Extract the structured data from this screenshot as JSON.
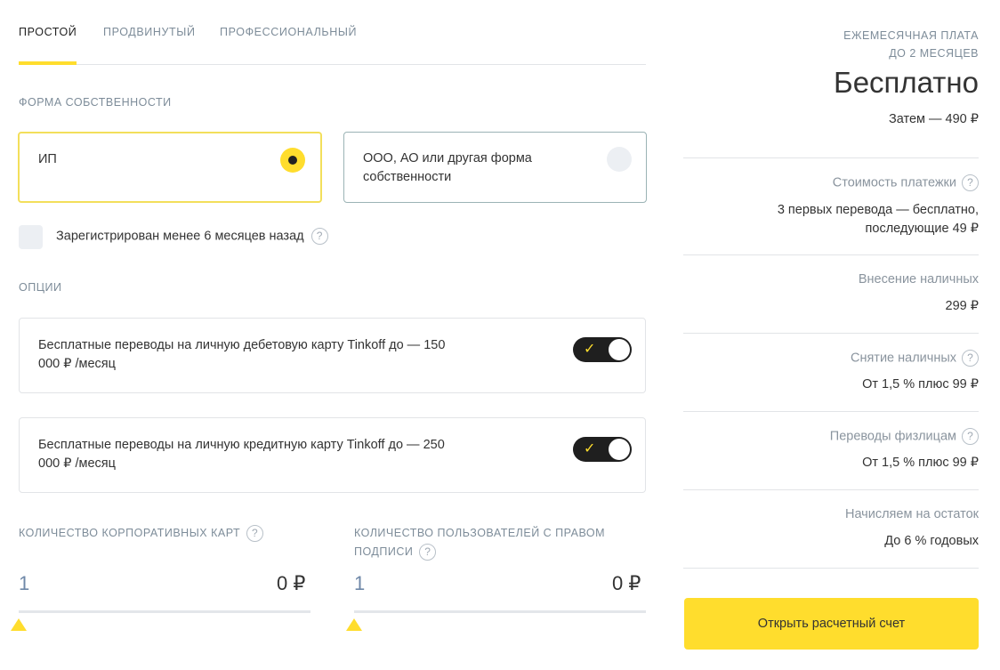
{
  "tabs": [
    {
      "label": "ПРОСТОЙ",
      "active": true
    },
    {
      "label": "ПРОДВИНУТЫЙ",
      "active": false
    },
    {
      "label": "ПРОФЕССИОНАЛЬНЫЙ",
      "active": false
    }
  ],
  "ownership": {
    "label": "ФОРМА СОБСТВЕННОСТИ",
    "options": [
      {
        "label": "ИП",
        "selected": true
      },
      {
        "label": "ООО, АО или другая форма собственности",
        "selected": false
      }
    ]
  },
  "registered": {
    "label": "Зарегистрирован менее 6 месяцев назад",
    "checked": false,
    "help": "?"
  },
  "options": {
    "label": "ОПЦИИ",
    "items": [
      {
        "text": "Бесплатные переводы на личную дебетовую карту Tinkoff до — 150 000 ₽ /месяц",
        "enabled": true
      },
      {
        "text": "Бесплатные переводы на личную кредитную карту Tinkoff до — 250 000 ₽ /месяц",
        "enabled": true
      }
    ]
  },
  "sliders": [
    {
      "label": "КОЛИЧЕСТВО КОРПОРАТИВНЫХ КАРТ",
      "value": "1",
      "price": "0 ₽",
      "help": "?"
    },
    {
      "label": "КОЛИЧЕСТВО ПОЛЬЗОВАТЕЛЕЙ С ПРАВОМ ПОДПИСИ",
      "value": "1",
      "price": "0 ₽",
      "help": "?"
    }
  ],
  "summary": {
    "fee_caption_line1": "ЕЖЕМЕСЯЧНАЯ ПЛАТА",
    "fee_caption_line2": "ДО 2 МЕСЯЦЕВ",
    "fee_value": "Бесплатно",
    "fee_then": "Затем — 490 ₽",
    "rows": [
      {
        "label": "Стоимость платежки",
        "value_line1": "3 первых перевода — бесплатно,",
        "value_line2": "последующие 49 ₽",
        "help": "?"
      },
      {
        "label": "Внесение наличных",
        "value_line1": "299 ₽"
      },
      {
        "label": "Снятие наличных",
        "value_line1": "От 1,5 % плюс 99 ₽",
        "help": "?"
      },
      {
        "label": "Переводы физлицам",
        "value_line1": "От 1,5 % плюс 99 ₽",
        "help": "?"
      },
      {
        "label": "Начисляем на остаток",
        "value_line1": "До 6 % годовых"
      }
    ],
    "cta": "Открыть расчетный счет"
  },
  "colors": {
    "accent": "#ffdd2d",
    "toggle": "#1f1f1f",
    "muted": "#7d8c99"
  }
}
